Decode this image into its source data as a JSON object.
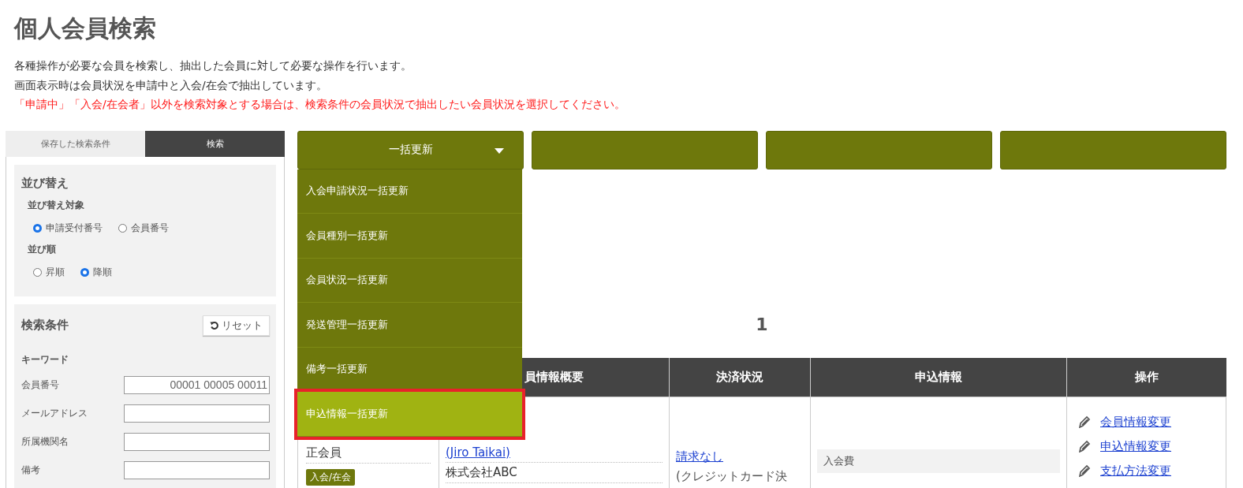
{
  "page": {
    "title": "個人会員検索",
    "description": [
      "各種操作が必要な会員を検索し、抽出した会員に対して必要な操作を行います。",
      "画面表示時は会員状況を申請中と入会/在会で抽出しています。"
    ],
    "warning": "「申請中」「入会/在会者」以外を検索対象とする場合は、検索条件の会員状況で抽出したい会員状況を選択してください。"
  },
  "sidebar": {
    "tabs": [
      {
        "label": "保存した検索条件",
        "selected": false
      },
      {
        "label": "検索",
        "selected": true
      }
    ],
    "sort": {
      "title": "並び替え",
      "target_label": "並び替え対象",
      "targets": [
        {
          "label": "申請受付番号",
          "selected": true
        },
        {
          "label": "会員番号",
          "selected": false
        }
      ],
      "order_label": "並び順",
      "orders": [
        {
          "label": "昇順",
          "selected": false
        },
        {
          "label": "降順",
          "selected": true
        }
      ]
    },
    "search": {
      "title": "検索条件",
      "reset": "リセット",
      "keyword_label": "キーワード",
      "fields": [
        {
          "label": "会員番号",
          "value": "00001 00005 00011"
        },
        {
          "label": "メールアドレス"
        },
        {
          "label": "所属機関名"
        },
        {
          "label": "備考"
        }
      ]
    }
  },
  "toolbar": {
    "menu_button": {
      "label": "一括更新",
      "expanded": true
    },
    "menu_items": [
      {
        "label": "入会申請状況一括更新",
        "selected": false
      },
      {
        "label": "会員種別一括更新",
        "selected": false
      },
      {
        "label": "会員状況一括更新",
        "selected": false
      },
      {
        "label": "発送管理一括更新",
        "selected": false
      },
      {
        "label": "備考一括更新",
        "selected": false
      },
      {
        "label": "申込情報一括更新",
        "selected": true
      }
    ]
  },
  "pagination": {
    "pages": [
      "1"
    ]
  },
  "table": {
    "columns": [
      "員情報概要",
      "決済状況",
      "申込情報",
      "操作"
    ],
    "row": {
      "member_type": "正会員",
      "status_badge": "入会/在会",
      "name_link": "(Jiro Taikai)",
      "organization": "株式会社ABC",
      "payment_link": "請求なし",
      "payment_note": "(クレジットカード決",
      "fee_label": "入会費",
      "actions": [
        "会員情報変更",
        "申込情報変更",
        "支払方法変更"
      ]
    }
  }
}
